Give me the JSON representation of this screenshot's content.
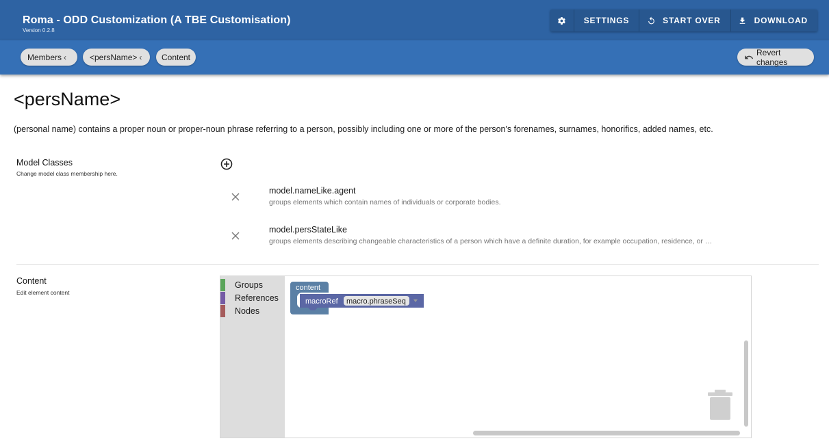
{
  "appbar": {
    "title": "Roma - ODD Customization (A TBE Customisation)",
    "version": "Version 0.2.8",
    "actions": [
      {
        "label": "",
        "icon": "gear-icon"
      },
      {
        "label": "SETTINGS"
      },
      {
        "label": "START OVER",
        "icon": "restart-icon"
      },
      {
        "label": "DOWNLOAD",
        "icon": "download-icon"
      }
    ]
  },
  "breadcrumbs": {
    "members": "Members",
    "element": "<persName>",
    "current": "Content",
    "revert": "Revert changes"
  },
  "element": {
    "name": "<persName>",
    "description": "(personal name) contains a proper noun or proper-noun phrase referring to a person, possibly including one or more of the person's forenames, surnames, honorifics, added names, etc."
  },
  "model_classes": {
    "title": "Model Classes",
    "subtitle": "Change model class membership here.",
    "items": [
      {
        "name": "model.nameLike.agent",
        "desc": "groups elements which contain names of individuals or corporate bodies."
      },
      {
        "name": "model.persStateLike",
        "desc": "groups elements describing changeable characteristics of a person which have a definite duration, for example occupation, residence, or …"
      }
    ]
  },
  "content_section": {
    "title": "Content",
    "subtitle": "Edit element content"
  },
  "blockly": {
    "categories": [
      {
        "label": "Groups",
        "color": "#5ba55b"
      },
      {
        "label": "References",
        "color": "#745ba5"
      },
      {
        "label": "Nodes",
        "color": "#a55b5b"
      }
    ],
    "content_block": "content",
    "macro_ref_label": "macroRef",
    "macro_ref_value": "macro.phraseSeq",
    "colors": {
      "content_block": "#5b80a5",
      "macro_block": "#5b67a5"
    }
  },
  "colors": {
    "appbar": "#2e63a3",
    "toolbar": "#3570b6"
  }
}
